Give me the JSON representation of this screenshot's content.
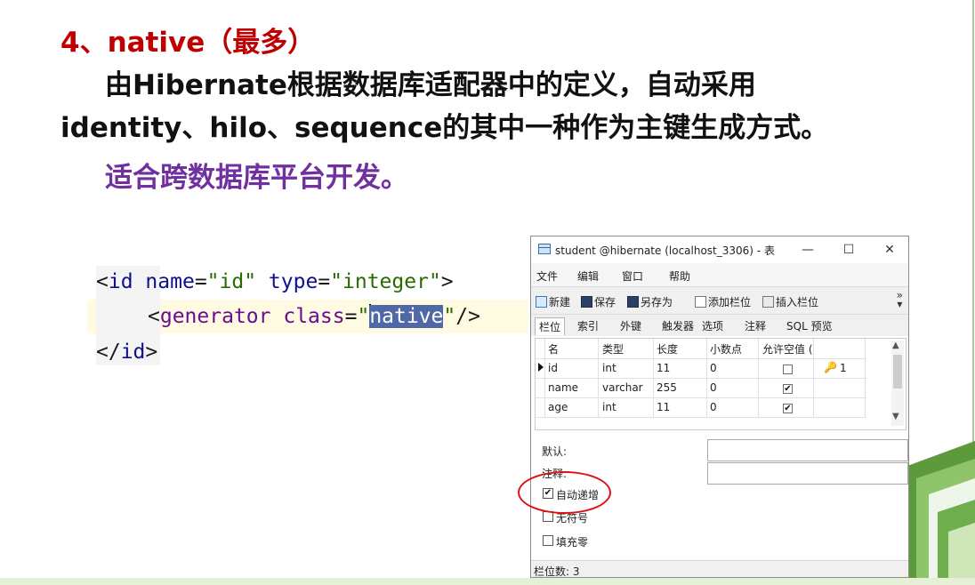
{
  "slide": {
    "heading": "4、native（最多）",
    "para1": "由Hibernate根据数据库适配器中的定义，自动采用",
    "para2": "identity、hilo、sequence的其中一种作为主键生成方式。",
    "para3": "适合跨数据库平台开发。"
  },
  "code": {
    "line1": {
      "open": "<",
      "tag": "id",
      "attr1": "name",
      "eq1": "=",
      "val1": "\"id\"",
      "attr2": "type",
      "eq2": "=",
      "val2": "\"integer\"",
      "close": ">"
    },
    "line2": {
      "open": "<",
      "tag": "generator",
      "attr": "class",
      "eq": "=",
      "q1": "\"",
      "selected": "native",
      "q2": "\"",
      "close": "/>"
    },
    "line3": {
      "open": "</",
      "tag": "id",
      "close": ">"
    }
  },
  "window": {
    "title": "student @hibernate (localhost_3306) - 表",
    "controls": {
      "minimize": "—",
      "maximize": "☐",
      "close": "✕"
    },
    "menu": [
      "文件",
      "编辑",
      "窗口",
      "帮助"
    ],
    "toolbar": {
      "new": "新建",
      "save": "保存",
      "save_as": "另存为",
      "add_column": "添加栏位",
      "insert_column": "插入栏位",
      "more": "»"
    },
    "tabs": [
      "栏位",
      "索引",
      "外键",
      "触发器",
      "选项",
      "注释",
      "SQL 预览"
    ],
    "active_tab": "栏位",
    "columns": [
      "名",
      "类型",
      "长度",
      "小数点",
      "允许空值 ("
    ],
    "rows": [
      {
        "name": "id",
        "type": "int",
        "length": "11",
        "decimal": "0",
        "nullable": false,
        "key": "1"
      },
      {
        "name": "name",
        "type": "varchar",
        "length": "255",
        "decimal": "0",
        "nullable": true,
        "key": ""
      },
      {
        "name": "age",
        "type": "int",
        "length": "11",
        "decimal": "0",
        "nullable": true,
        "key": ""
      }
    ],
    "props": {
      "default_label": "默认:",
      "comment_label": "注释:",
      "auto_increment": "自动递增",
      "auto_increment_checked": true,
      "unsigned": "无符号",
      "unsigned_checked": false,
      "zerofill": "填充零",
      "zerofill_checked": false
    },
    "status": "栏位数: 3"
  }
}
